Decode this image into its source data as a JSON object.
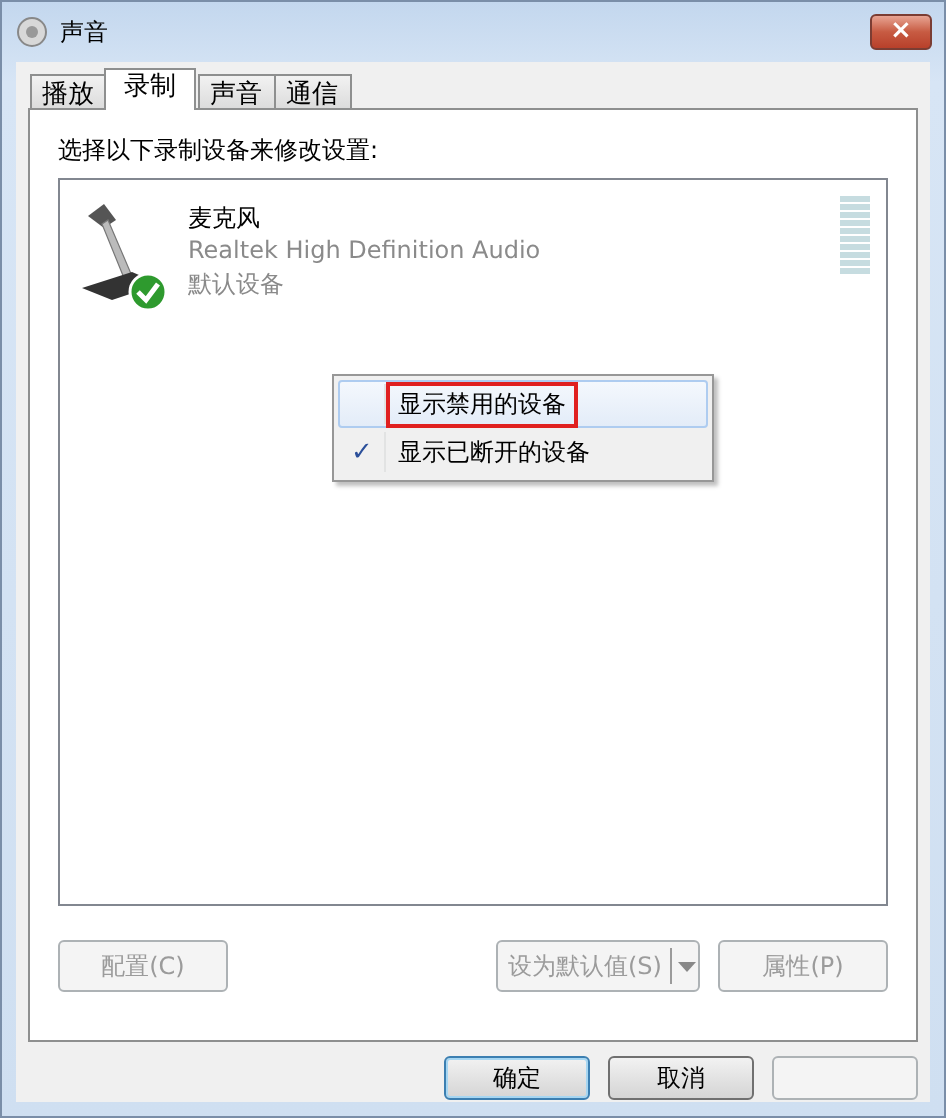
{
  "window": {
    "title": "声音",
    "close": "×"
  },
  "tabs": [
    {
      "label": "播放",
      "selected": false
    },
    {
      "label": "录制",
      "selected": true
    },
    {
      "label": "声音",
      "selected": false
    },
    {
      "label": "通信",
      "selected": false
    }
  ],
  "instruction": "选择以下录制设备来修改设置:",
  "devices": [
    {
      "name": "麦克风",
      "driver": "Realtek High Definition Audio",
      "status": "默认设备",
      "default": true
    }
  ],
  "context_menu": [
    {
      "label": "显示禁用的设备",
      "checked": false,
      "hovered": true,
      "annotated": true
    },
    {
      "label": "显示已断开的设备",
      "checked": true,
      "hovered": false,
      "annotated": false
    }
  ],
  "check_mark": "✓",
  "panel_buttons": [
    {
      "kind": "plain",
      "label": "配置(C)",
      "disabled": true
    },
    {
      "kind": "split",
      "label": "设为默认值(S)",
      "disabled": true
    },
    {
      "kind": "plain",
      "label": "属性(P)",
      "disabled": true
    }
  ],
  "dialog_buttons": [
    {
      "label": "确定",
      "disabled": false,
      "default": true
    },
    {
      "label": "取消",
      "disabled": false,
      "default": false
    },
    {
      "disabled": true,
      "default": false
    }
  ]
}
